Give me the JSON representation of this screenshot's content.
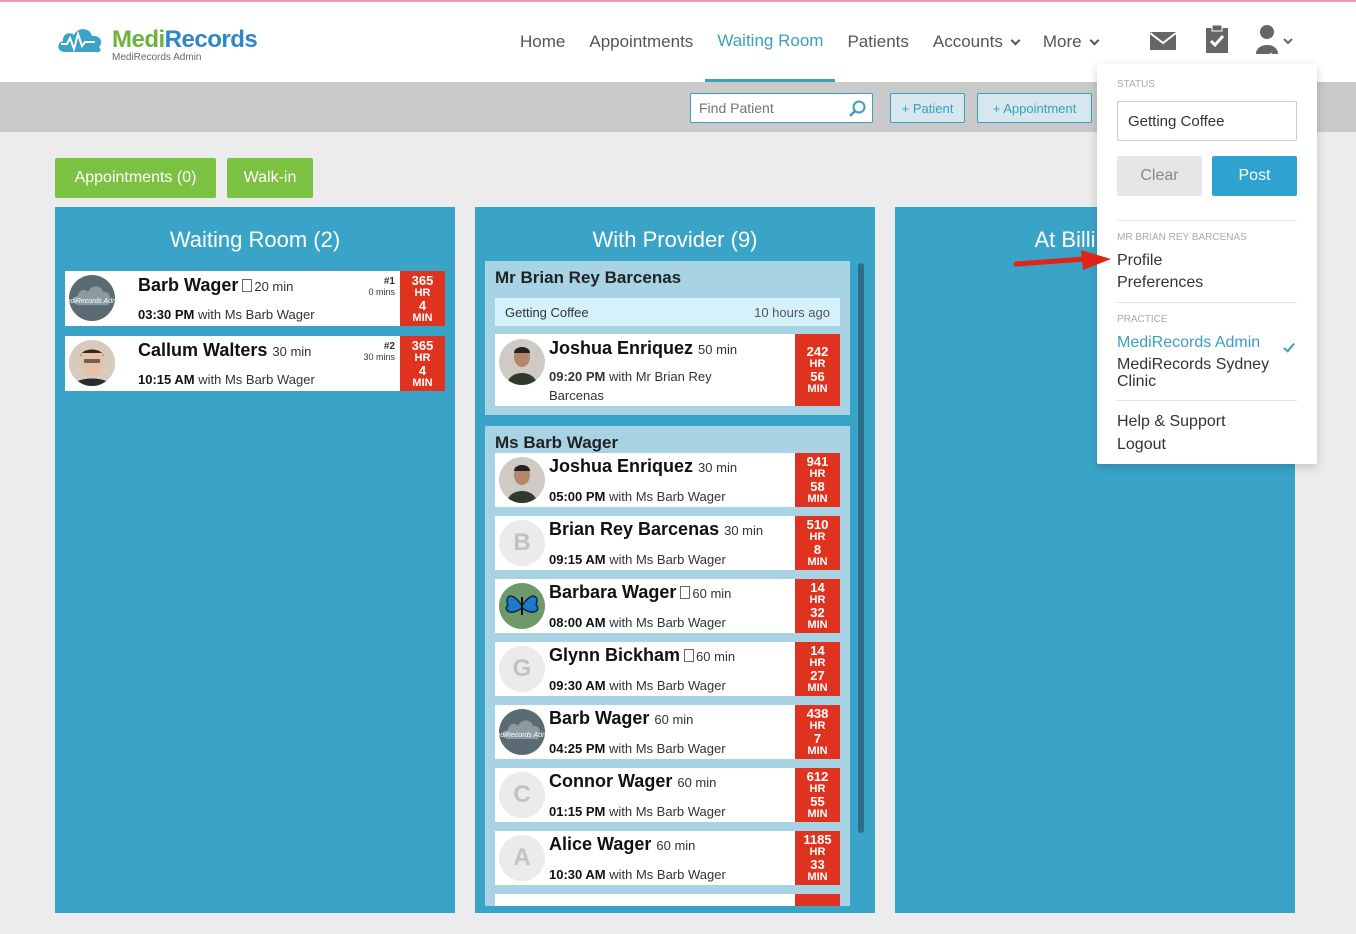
{
  "brand": {
    "name_part1": "Medi",
    "name_part2": "Records",
    "subtitle": "MediRecords Admin",
    "green": "#6fb33f",
    "blue": "#2f86c8"
  },
  "nav": {
    "items": [
      {
        "label": "Home"
      },
      {
        "label": "Appointments"
      },
      {
        "label": "Waiting Room",
        "active": true
      },
      {
        "label": "Patients"
      },
      {
        "label": "Accounts",
        "dropdown": true
      },
      {
        "label": "More",
        "dropdown": true
      }
    ],
    "icons": [
      "mail-icon",
      "clipboard-check-icon",
      "user-icon"
    ]
  },
  "toolbar": {
    "search_placeholder": "Find Patient",
    "add_patient": "+ Patient",
    "add_appointment": "+ Appointment"
  },
  "filters": {
    "appointments": "Appointments (0)",
    "walkin": "Walk-in"
  },
  "columns": {
    "waiting": {
      "title": "Waiting Room (2)",
      "patients": [
        {
          "name": "Barb Wager",
          "duration": "20 min",
          "has_doc": true,
          "time": "03:30 PM",
          "with": "with Ms Barb Wager",
          "queue": "#1",
          "queue_wait": "0 mins",
          "hr": "365",
          "hr_label": "HR",
          "min": "4",
          "min_label": "MIN"
        },
        {
          "name": "Callum Walters",
          "duration": "30 min",
          "has_doc": false,
          "time": "10:15 AM",
          "with": "with Ms Barb Wager",
          "queue": "#2",
          "queue_wait": "30 mins",
          "hr": "365",
          "hr_label": "HR",
          "min": "4",
          "min_label": "MIN"
        }
      ]
    },
    "provider": {
      "title": "With Provider (9)",
      "groups": [
        {
          "provider": "Mr Brian Rey Barcenas",
          "status": "Getting Coffee",
          "status_ago": "10 hours ago",
          "patients": [
            {
              "name": "Joshua Enriquez",
              "duration": "50 min",
              "time": "09:20 PM",
              "with": "with Mr Brian Rey Barcenas",
              "hr": "242",
              "hr_label": "HR",
              "min": "56",
              "min_label": "MIN"
            }
          ]
        },
        {
          "provider": "Ms Barb Wager",
          "patients": [
            {
              "name": "Joshua Enriquez",
              "duration": "30 min",
              "time": "05:00 PM",
              "with": "with Ms Barb Wager",
              "hr": "941",
              "hr_label": "HR",
              "min": "58",
              "min_label": "MIN",
              "avatar": "photo"
            },
            {
              "name": "Brian Rey Barcenas",
              "duration": "30 min",
              "time": "09:15 AM",
              "with": "with Ms Barb Wager",
              "hr": "510",
              "hr_label": "HR",
              "min": "8",
              "min_label": "MIN",
              "letter": "B"
            },
            {
              "name": "Barbara Wager",
              "duration": "60 min",
              "time": "08:00 AM",
              "with": "with Ms Barb Wager",
              "hr": "14",
              "hr_label": "HR",
              "min": "32",
              "min_label": "MIN",
              "avatar": "butterfly",
              "has_doc": true
            },
            {
              "name": "Glynn Bickham",
              "duration": "60 min",
              "time": "09:30 AM",
              "with": "with Ms Barb Wager",
              "hr": "14",
              "hr_label": "HR",
              "min": "27",
              "min_label": "MIN",
              "letter": "G",
              "has_doc": true
            },
            {
              "name": "Barb Wager",
              "duration": "60 min",
              "time": "04:25 PM",
              "with": "with Ms Barb Wager",
              "hr": "438",
              "hr_label": "HR",
              "min": "7",
              "min_label": "MIN",
              "avatar": "logo"
            },
            {
              "name": "Connor Wager",
              "duration": "60 min",
              "time": "01:15 PM",
              "with": "with Ms Barb Wager",
              "hr": "612",
              "hr_label": "HR",
              "min": "55",
              "min_label": "MIN",
              "letter": "C"
            },
            {
              "name": "Alice Wager",
              "duration": "60 min",
              "time": "10:30 AM",
              "with": "with Ms Barb Wager",
              "hr": "1185",
              "hr_label": "HR",
              "min": "33",
              "min_label": "MIN",
              "letter": "A"
            }
          ]
        }
      ]
    },
    "billing": {
      "title": "At Billi"
    }
  },
  "user_menu": {
    "status_label": "STATUS",
    "status_value": "Getting Coffee",
    "clear": "Clear",
    "post": "Post",
    "user_label": "MR BRIAN REY BARCENAS",
    "profile": "Profile",
    "preferences": "Preferences",
    "practice_label": "PRACTICE",
    "practice_selected": "MediRecords Admin",
    "practice_other_line1": "MediRecords Sydney",
    "practice_other_line2": "Clinic",
    "help": "Help & Support",
    "logout": "Logout"
  },
  "colors": {
    "accent": "#3a9fc0",
    "column_bg": "#3aa3c8",
    "group_bg": "#a7d3e4",
    "timer_red": "#e0331f",
    "green_button": "#7cc242",
    "post_button": "#2fa3cf"
  }
}
